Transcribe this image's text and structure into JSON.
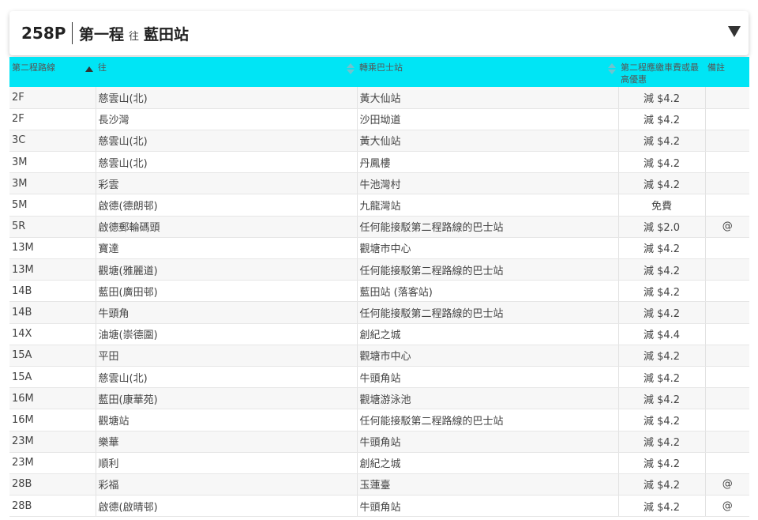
{
  "header": {
    "route_code": "258P",
    "first_leg": "第一程",
    "to_word": "往",
    "stop": "藍田站"
  },
  "table": {
    "columns": {
      "route": "第二程路線",
      "to": "往",
      "stop": "轉乘巴士站",
      "fare": "第二程應繳車費或最高優惠",
      "remark": "備註"
    },
    "rows": [
      {
        "route": "2F",
        "to": "慈雲山(北)",
        "stop": "黃大仙站",
        "fare": "減 $4.2",
        "remark": ""
      },
      {
        "route": "2F",
        "to": "長沙灣",
        "stop": "沙田坳道",
        "fare": "減 $4.2",
        "remark": ""
      },
      {
        "route": "3C",
        "to": "慈雲山(北)",
        "stop": "黃大仙站",
        "fare": "減 $4.2",
        "remark": ""
      },
      {
        "route": "3M",
        "to": "慈雲山(北)",
        "stop": "丹鳳樓",
        "fare": "減 $4.2",
        "remark": ""
      },
      {
        "route": "3M",
        "to": "彩雲",
        "stop": "牛池灣村",
        "fare": "減 $4.2",
        "remark": ""
      },
      {
        "route": "5M",
        "to": "啟德(德朗邨)",
        "stop": "九龍灣站",
        "fare": "免費",
        "remark": ""
      },
      {
        "route": "5R",
        "to": "啟德郵輪碼頭",
        "stop": "任何能接駁第二程路線的巴士站",
        "fare": "減 $2.0",
        "remark": "@"
      },
      {
        "route": "13M",
        "to": "寶達",
        "stop": "觀塘市中心",
        "fare": "減 $4.2",
        "remark": ""
      },
      {
        "route": "13M",
        "to": "觀塘(雅麗道)",
        "stop": "任何能接駁第二程路線的巴士站",
        "fare": "減 $4.2",
        "remark": ""
      },
      {
        "route": "14B",
        "to": "藍田(廣田邨)",
        "stop": "藍田站 (落客站)",
        "fare": "減 $4.2",
        "remark": ""
      },
      {
        "route": "14B",
        "to": "牛頭角",
        "stop": "任何能接駁第二程路線的巴士站",
        "fare": "減 $4.2",
        "remark": ""
      },
      {
        "route": "14X",
        "to": "油塘(崇德圍)",
        "stop": "創紀之城",
        "fare": "減 $4.4",
        "remark": ""
      },
      {
        "route": "15A",
        "to": "平田",
        "stop": "觀塘市中心",
        "fare": "減 $4.2",
        "remark": ""
      },
      {
        "route": "15A",
        "to": "慈雲山(北)",
        "stop": "牛頭角站",
        "fare": "減 $4.2",
        "remark": ""
      },
      {
        "route": "16M",
        "to": "藍田(康華苑)",
        "stop": "觀塘游泳池",
        "fare": "減 $4.2",
        "remark": ""
      },
      {
        "route": "16M",
        "to": "觀塘站",
        "stop": "任何能接駁第二程路線的巴士站",
        "fare": "減 $4.2",
        "remark": ""
      },
      {
        "route": "23M",
        "to": "樂華",
        "stop": "牛頭角站",
        "fare": "減 $4.2",
        "remark": ""
      },
      {
        "route": "23M",
        "to": "順利",
        "stop": "創紀之城",
        "fare": "減 $4.2",
        "remark": ""
      },
      {
        "route": "28B",
        "to": "彩福",
        "stop": "玉蓮臺",
        "fare": "減 $4.2",
        "remark": "@"
      },
      {
        "route": "28B",
        "to": "啟德(啟晴邨)",
        "stop": "牛頭角站",
        "fare": "減 $4.2",
        "remark": "@"
      }
    ]
  },
  "colors": {
    "header_bar": "#00e5f5"
  }
}
